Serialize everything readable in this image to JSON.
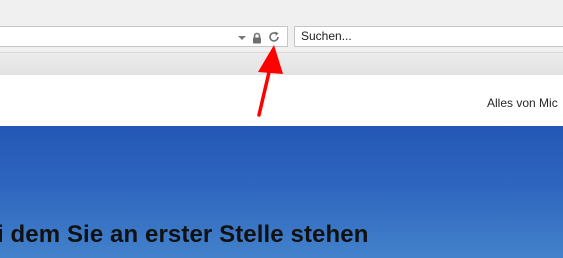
{
  "toolbar": {
    "search": {
      "placeholder": "Suchen..."
    },
    "icons": {
      "dropdown": "chevron-down-icon",
      "lock": "lock-icon",
      "refresh": "refresh-icon"
    }
  },
  "page": {
    "header_link": "Alles von Mic",
    "hero_headline": "i dem Sie an erster Stelle stehen"
  },
  "annotation": {
    "arrow_color": "#ff0000"
  },
  "colors": {
    "hero_top": "#2457b5",
    "hero_bottom": "#4382cb"
  }
}
